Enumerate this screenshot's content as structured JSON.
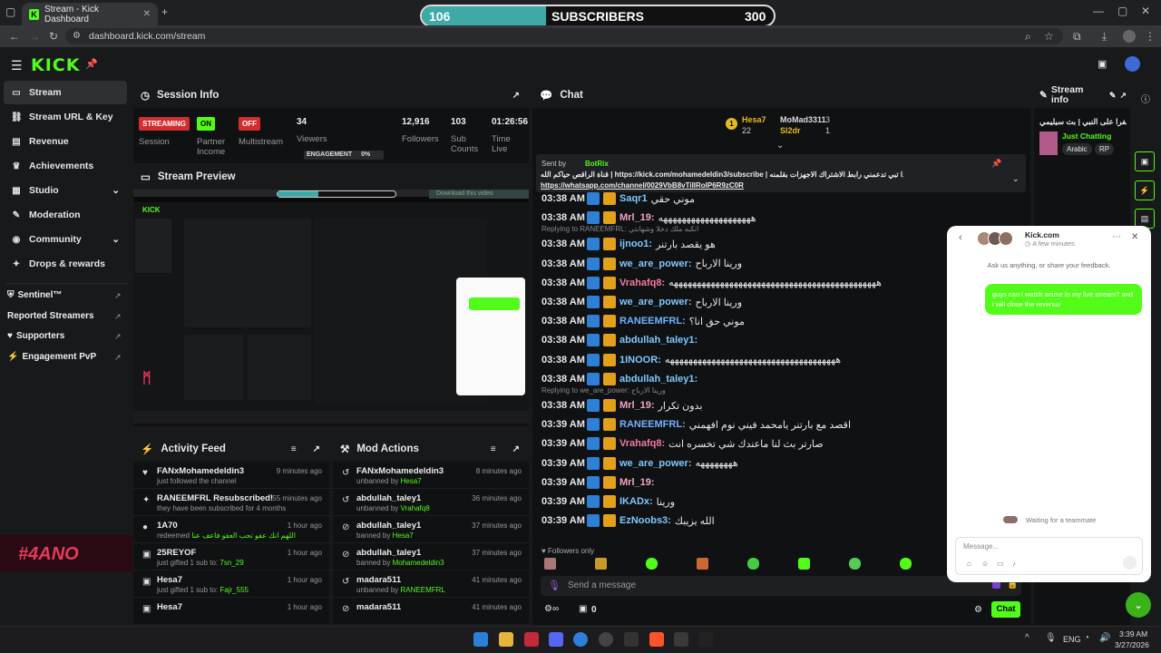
{
  "browser": {
    "tab_title": "Stream - Kick Dashboard",
    "url": "dashboard.kick.com/stream"
  },
  "overlay": {
    "subs_current": "106",
    "subs_label": "SUBSCRIBERS",
    "subs_goal": "300",
    "subs_progress": 0.353
  },
  "app": {
    "logo": "KICK",
    "sidebar": {
      "items": [
        {
          "label": "Stream",
          "icon": "stream-icon"
        },
        {
          "label": "Stream URL & Key",
          "icon": "link-icon"
        },
        {
          "label": "Revenue",
          "icon": "revenue-icon"
        },
        {
          "label": "Achievements",
          "icon": "trophy-icon"
        },
        {
          "label": "Studio",
          "icon": "studio-icon"
        },
        {
          "label": "Moderation",
          "icon": "wrench-icon"
        },
        {
          "label": "Community",
          "icon": "community-icon"
        },
        {
          "label": "Drops & rewards",
          "icon": "gift-icon"
        }
      ],
      "external": [
        {
          "label": "Sentinel™"
        },
        {
          "label": "Reported Streamers"
        },
        {
          "label": "Supporters"
        },
        {
          "label": "Engagement PvP"
        }
      ]
    },
    "session": {
      "title": "Session Info",
      "streaming": "STREAMING",
      "session_label": "Session",
      "partner_badge": "ON",
      "partner_label": "Partner Income",
      "multistream_badge": "OFF",
      "multistream_label": "Multistream",
      "viewers_value": "34",
      "viewers_label": "Viewers",
      "engagement_label": "ENGAGEMENT",
      "engagement_value": "0%",
      "followers_value": "12,916",
      "followers_label": "Followers",
      "subcounts_value": "103",
      "subcounts_label": "Sub Counts",
      "time_value": "01:26:56",
      "time_label": "Time Live"
    },
    "preview": {
      "title": "Stream Preview",
      "download": "Download this video"
    },
    "activity": {
      "title": "Activity Feed",
      "rows": [
        {
          "name": "FANxMohamedeldin3",
          "sub": "just followed the channel",
          "time": "9 minutes ago",
          "icon": "heart-icon"
        },
        {
          "name": "RANEEMFRL Resubscribed!",
          "sub": "they have been subscribed for 4 months",
          "time": "55 minutes ago",
          "icon": "star-icon"
        },
        {
          "name": "1A70",
          "sub": "redeemed",
          "extra": "اللهم انك عفو تحب العفو فاعف عنا",
          "time": "1 hour ago",
          "icon": "points-icon"
        },
        {
          "name": "25REYOF",
          "sub": "just gifted 1 sub to:",
          "extra": "7sn_29",
          "time": "1 hour ago",
          "icon": "gift-icon"
        },
        {
          "name": "Hesa7",
          "sub": "just gifted 1 sub to:",
          "extra": "Fajr_555",
          "time": "1 hour ago",
          "icon": "gift-icon"
        },
        {
          "name": "Hesa7",
          "sub": "",
          "time": "1 hour ago",
          "icon": "gift-icon"
        }
      ]
    },
    "modactions": {
      "title": "Mod Actions",
      "rows": [
        {
          "name": "FANxMohamedeldin3",
          "sub": "unbanned by",
          "by": "Hesa7",
          "time": "8 minutes ago",
          "icon": "undo-icon"
        },
        {
          "name": "abdullah_taley1",
          "sub": "unbanned by",
          "by": "Vrahafq8",
          "time": "36 minutes ago",
          "icon": "undo-icon"
        },
        {
          "name": "abdullah_taley1",
          "sub": "banned by",
          "by": "Hesa7",
          "time": "37 minutes ago",
          "icon": "ban-icon"
        },
        {
          "name": "abdullah_taley1",
          "sub": "banned by",
          "by": "Mohamedeldin3",
          "time": "37 minutes ago",
          "icon": "ban-icon"
        },
        {
          "name": "madara511",
          "sub": "unbanned by",
          "by": "RANEEMFRL",
          "time": "41 minutes ago",
          "icon": "undo-icon"
        },
        {
          "name": "madara511",
          "sub": "",
          "by": "",
          "time": "41 minutes ago",
          "icon": "ban-icon"
        }
      ]
    },
    "chat": {
      "title": "Chat",
      "leaderboard": [
        {
          "name": "Hesa7",
          "count": "22"
        },
        {
          "name": "MoMad3311",
          "count": "3"
        },
        {
          "name": "Sl2dr",
          "count": "1"
        }
      ],
      "pinned_sender": "Sent by",
      "pinned_bot": "BotRix",
      "pinned_text": "قناة الراقص حياكم الله | https://kick.com/mohamedeldin3/subscribe | اذا تبي تدعمني رابط الاشتراك الاجهزات بقلمنه :",
      "pinned_link": "https://whatsapp.com/channel/0029VbB8vTiIlRoIP6R9zC0R",
      "messages": [
        {
          "time": "03:38 AM",
          "user": "Saqr1",
          "color": "#7ec8ff",
          "text": "موني حقي"
        },
        {
          "time": "03:38 AM",
          "user": "Mrl_19:",
          "color": "#f1a4c8",
          "text": "ههههههههههههههههههههه"
        },
        {
          "reply": "Replying to RANEEMFRL: انكبه ملك دخلا وشهابتي"
        },
        {
          "time": "03:38 AM",
          "user": "ijnoo1:",
          "color": "#7ec8ff",
          "text": "هو يقصد بارتنر"
        },
        {
          "time": "03:38 AM",
          "user": "we_are_power:",
          "color": "#7ec8ff",
          "text": "ورينا الارباح"
        },
        {
          "time": "03:38 AM",
          "user": "Vrahafq8:",
          "color": "#f07aa0",
          "text": "هههههههههههههههههههههههههههههههههههههههههههههه"
        },
        {
          "time": "03:38 AM",
          "user": "we_are_power:",
          "color": "#7ec8ff",
          "text": "ورينا الارباح"
        },
        {
          "time": "03:38 AM",
          "user": "RANEEMFRL:",
          "color": "#6fb4ff",
          "text": "موني حق انا؟"
        },
        {
          "time": "03:38 AM",
          "user": "abdullah_taley1:",
          "color": "#7ec8ff",
          "text": ""
        },
        {
          "time": "03:38 AM",
          "user": "1INOOR:",
          "color": "#7ec8ff",
          "text": "هههههههههههههههههههههههههههههههههههههه"
        },
        {
          "time": "03:38 AM",
          "user": "abdullah_taley1:",
          "color": "#7ec8ff",
          "text": ""
        },
        {
          "reply": "Replying to we_are_power: ورينا الارباح"
        },
        {
          "time": "03:38 AM",
          "user": "Mrl_19:",
          "color": "#f1a4c8",
          "text": "بدون تكرار"
        },
        {
          "time": "03:39 AM",
          "user": "RANEEMFRL:",
          "color": "#6fb4ff",
          "text": "اقصد مع بارتنر يامحمد فيني نوم افهمني"
        },
        {
          "time": "03:39 AM",
          "user": "Vrahafq8:",
          "color": "#f07aa0",
          "text": "صارتر بث لنا ماعندك شي تخسره انت"
        },
        {
          "time": "03:39 AM",
          "user": "we_are_power:",
          "color": "#7ec8ff",
          "text": "ههههههههه"
        },
        {
          "time": "03:39 AM",
          "user": "Mrl_19:",
          "color": "#f1a4c8",
          "text": ""
        },
        {
          "time": "03:39 AM",
          "user": "IKADx:",
          "color": "#7ec8ff",
          "text": "ورينا"
        },
        {
          "time": "03:39 AM",
          "user": "EzNoobs3:",
          "color": "#7ec8ff",
          "text": "الله يزيبك"
        }
      ],
      "followers_only": "Followers only",
      "placeholder": "Send a message",
      "points": "0",
      "send": "Chat"
    },
    "streaminfo": {
      "title": "Stream info",
      "stream_title": "سفرا على النبي | بث سيليمي",
      "category": "Just Chatting",
      "tags": [
        "Arabic",
        "RP"
      ]
    },
    "popup": {
      "brand": "Kick.com",
      "status": "A few minutes",
      "intro": "Ask us anything, or share your feedback.",
      "user_msg": "guys can i watch anime in my live stream? and i will close the revenue",
      "waiting": "Waiting for a teammate",
      "placeholder": "Message..."
    }
  },
  "taskbar": {
    "lang": "ENG",
    "time": "3:39 AM",
    "date": "3/27/2026"
  }
}
